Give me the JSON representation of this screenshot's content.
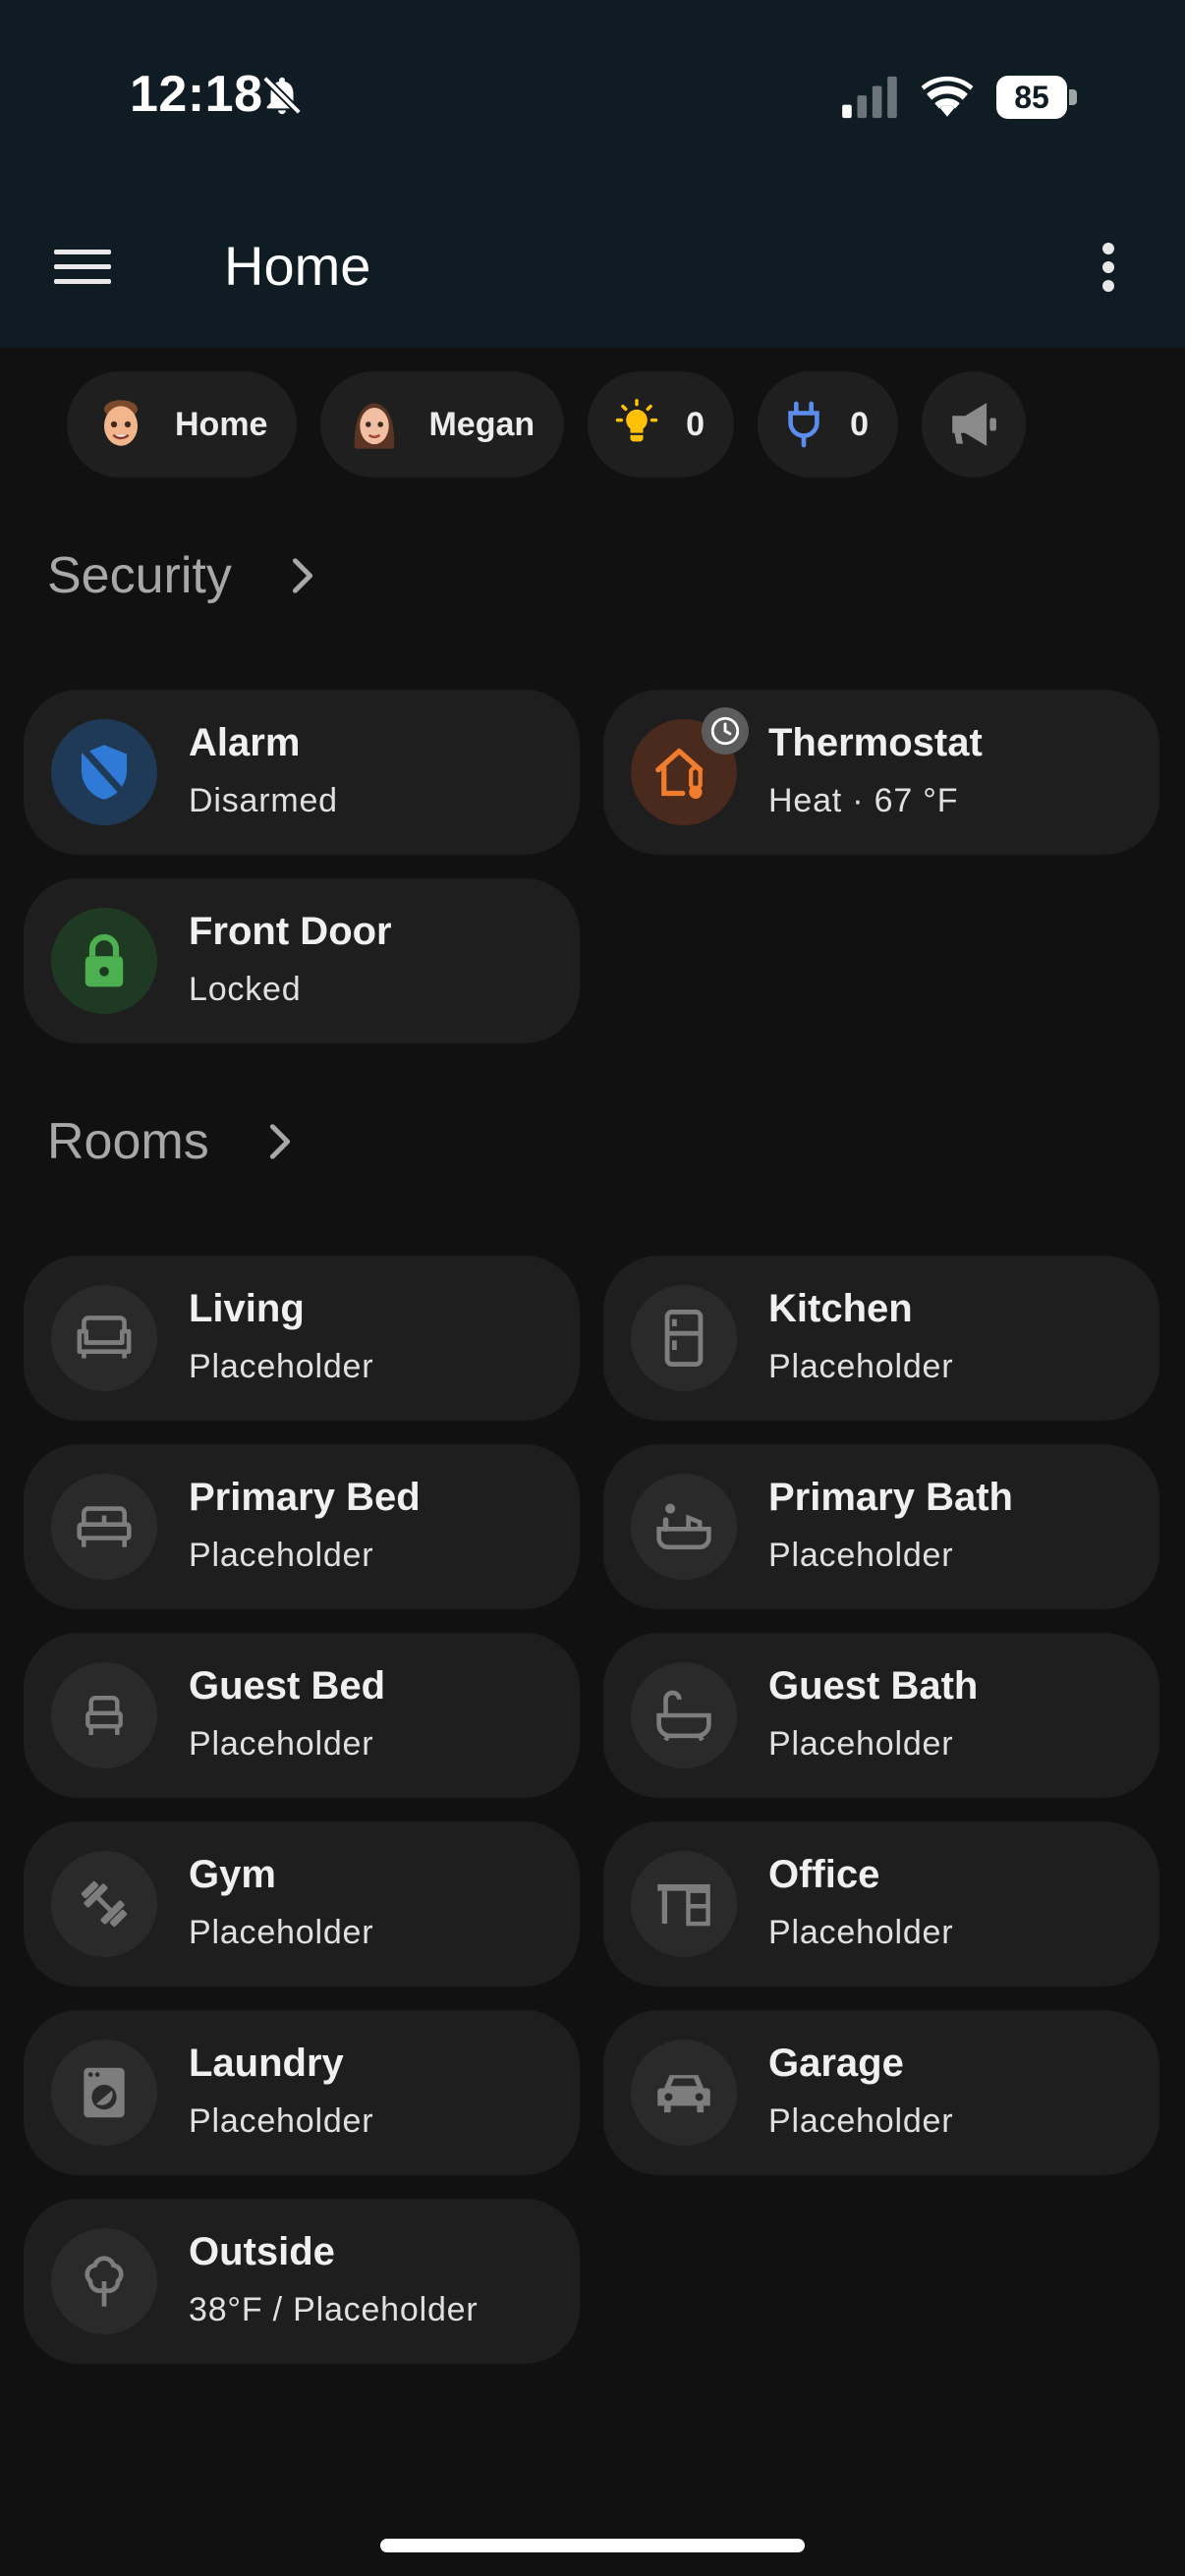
{
  "status_bar": {
    "time": "12:18",
    "battery": "85"
  },
  "app_bar": {
    "title": "Home"
  },
  "chips": {
    "home": {
      "label": "Home"
    },
    "megan": {
      "label": "Megan"
    },
    "lights": {
      "count": "0",
      "icon": "lightbulb-icon",
      "color": "#ffc107"
    },
    "plugs": {
      "count": "0",
      "icon": "plug-icon",
      "color": "#5b8def"
    },
    "announce": {
      "icon": "megaphone-icon"
    }
  },
  "security": {
    "title": "Security",
    "cards": [
      {
        "name": "Alarm",
        "state": "Disarmed",
        "icon": "shield-off-icon",
        "color": "#2f7ad6"
      },
      {
        "name": "Thermostat",
        "state": "Heat · 67 °F",
        "icon": "home-thermometer-icon",
        "color": "#f07c2e"
      },
      {
        "name": "Front Door",
        "state": "Locked",
        "icon": "lock-icon",
        "color": "#4caf50"
      }
    ]
  },
  "rooms": {
    "title": "Rooms",
    "cards": [
      {
        "name": "Living",
        "state": "Placeholder",
        "icon": "sofa-icon"
      },
      {
        "name": "Kitchen",
        "state": "Placeholder",
        "icon": "fridge-icon"
      },
      {
        "name": "Primary Bed",
        "state": "Placeholder",
        "icon": "bed-icon"
      },
      {
        "name": "Primary Bath",
        "state": "Placeholder",
        "icon": "bathtub-person-icon"
      },
      {
        "name": "Guest Bed",
        "state": "Placeholder",
        "icon": "bed-single-icon"
      },
      {
        "name": "Guest Bath",
        "state": "Placeholder",
        "icon": "bathtub-icon"
      },
      {
        "name": "Gym",
        "state": "Placeholder",
        "icon": "dumbbell-icon"
      },
      {
        "name": "Office",
        "state": "Placeholder",
        "icon": "desk-icon"
      },
      {
        "name": "Laundry",
        "state": "Placeholder",
        "icon": "washing-machine-icon"
      },
      {
        "name": "Garage",
        "state": "Placeholder",
        "icon": "car-icon"
      },
      {
        "name": "Outside",
        "state": "38°F / Placeholder",
        "icon": "tree-icon"
      }
    ]
  }
}
